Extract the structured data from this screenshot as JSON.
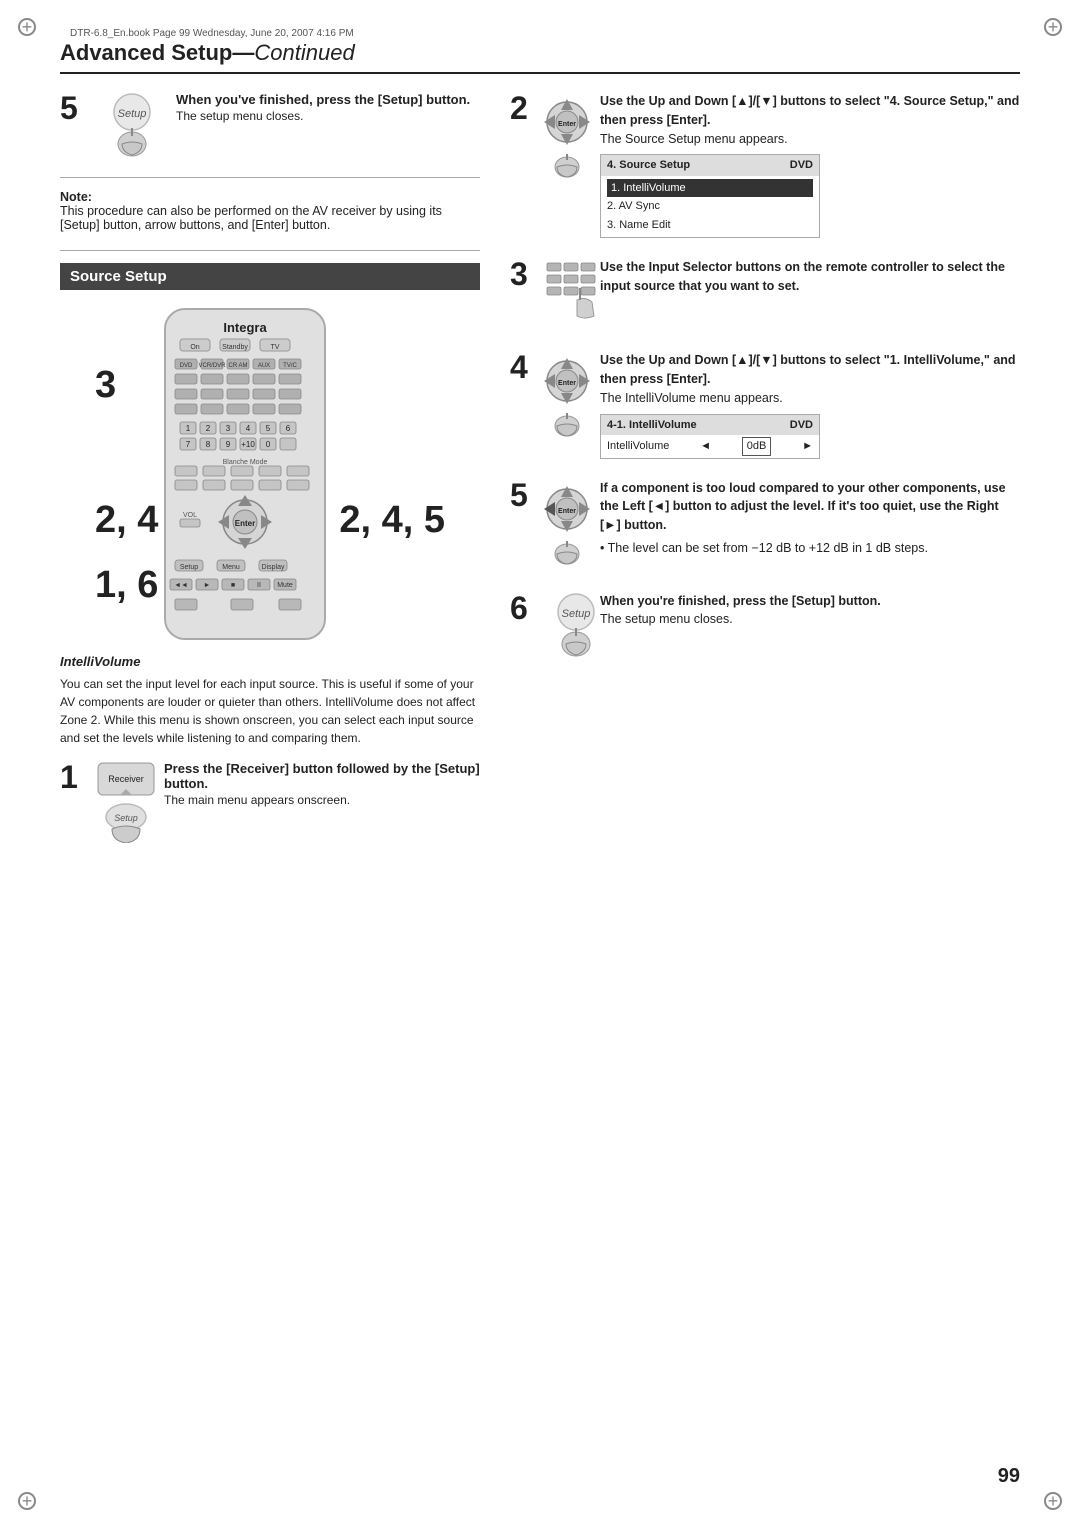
{
  "file_info": "DTR-6.8_En.book  Page 99  Wednesday, June 20, 2007  4:16 PM",
  "header": {
    "title": "Advanced Setup",
    "subtitle": "Continued"
  },
  "left_col": {
    "step5": {
      "number": "5",
      "heading": "When you've finished, press the [Setup] button.",
      "body": "The setup menu closes."
    },
    "note": {
      "label": "Note:",
      "text": "This procedure can also be performed on the AV receiver by using its [Setup] button, arrow buttons, and [Enter] button."
    },
    "source_setup": {
      "title": "Source Setup"
    },
    "remote_labels": {
      "label_3": "3",
      "label_2_4": "2, 4",
      "label_1_6": "1, 6",
      "label_2_4_5": "2, 4, 5"
    },
    "intelli_volume": {
      "title": "IntelliVolume",
      "text": "You can set the input level for each input source. This is useful if some of your AV components are louder or quieter than others. IntelliVolume does not affect Zone 2. While this menu is shown onscreen, you can select each input source and set the levels while listening to and comparing them."
    },
    "step1": {
      "number": "1",
      "heading": "Press the [Receiver] button followed by the [Setup] button.",
      "body": "The main menu appears onscreen.",
      "button1": "Receiver",
      "button2": "Setup"
    }
  },
  "right_col": {
    "step2": {
      "number": "2",
      "heading": "Use the Up and Down [▲]/[▼] buttons to select \"4. Source Setup,\" and then press [Enter].",
      "body": "The Source Setup menu appears.",
      "menu": {
        "title": "4. Source Setup",
        "tab": "DVD",
        "items": [
          {
            "label": "1. IntelliVolume",
            "selected": true
          },
          {
            "label": "2. AV Sync"
          },
          {
            "label": "3. Name Edit"
          }
        ]
      }
    },
    "step3": {
      "number": "3",
      "heading": "Use the Input Selector buttons on the remote controller to select the input source that you want to set."
    },
    "step4": {
      "number": "4",
      "heading": "Use the Up and Down [▲]/[▼] buttons to select \"1. IntelliVolume,\" and then press [Enter].",
      "body": "The IntelliVolume menu appears.",
      "menu": {
        "title": "4-1. IntelliVolume",
        "tab": "DVD",
        "row_label": "IntelliVolume",
        "row_value": "0dB"
      }
    },
    "step5": {
      "number": "5",
      "heading_part1": "If a component is too loud compared to your other components, use the Left [◄] button to adjust the level. If it's too quiet, use the Right [►] button.",
      "bullet": "The level can be set from −12 dB to +12 dB in 1 dB steps."
    },
    "step6": {
      "number": "6",
      "heading": "When you're finished, press the [Setup] button.",
      "body": "The setup menu closes."
    }
  },
  "page_number": "99"
}
